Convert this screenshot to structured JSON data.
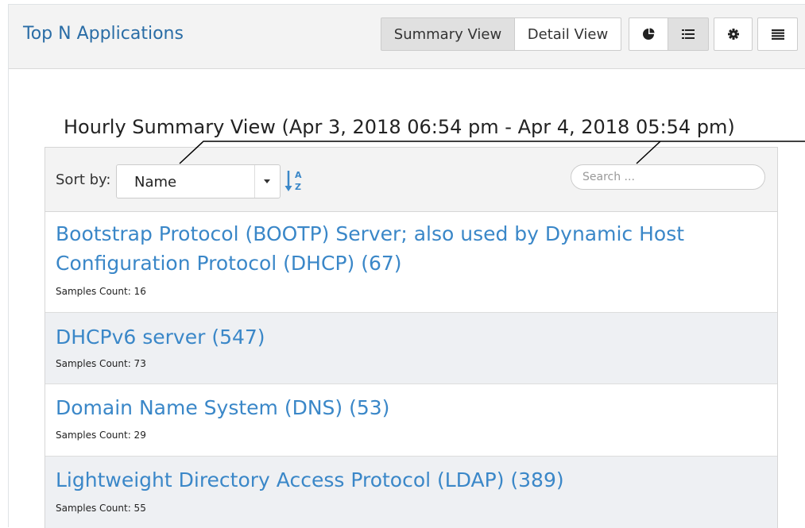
{
  "panel": {
    "title": "Top N Applications"
  },
  "header": {
    "view_buttons": {
      "summary": "Summary View",
      "detail": "Detail View"
    },
    "icons": {
      "pie": "pie-chart-icon",
      "list": "list-icon",
      "gear": "gear-icon",
      "menu": "menu-icon"
    },
    "active_view": "Summary View"
  },
  "summary": {
    "title": "Hourly Summary View (Apr 3, 2018 06:54 pm - Apr 4, 2018 05:54 pm)"
  },
  "toolbar": {
    "sort_label": "Sort by:",
    "sort_value": "Name",
    "sort_direction_icon": "sort-alpha-asc-icon",
    "search_placeholder": "Search ..."
  },
  "colors": {
    "accent": "#3a87c8",
    "title": "#2a6da6",
    "row_alt": "#eef0f3"
  },
  "applications": [
    {
      "name": "Bootstrap Protocol (BOOTP) Server; also used by Dynamic Host Configuration Protocol (DHCP) (67)",
      "samples": "Samples Count: 16"
    },
    {
      "name": "DHCPv6 server (547)",
      "samples": "Samples Count: 73"
    },
    {
      "name": "Domain Name System (DNS) (53)",
      "samples": "Samples Count: 29"
    },
    {
      "name": "Lightweight Directory Access Protocol (LDAP) (389)",
      "samples": "Samples Count: 55"
    }
  ]
}
